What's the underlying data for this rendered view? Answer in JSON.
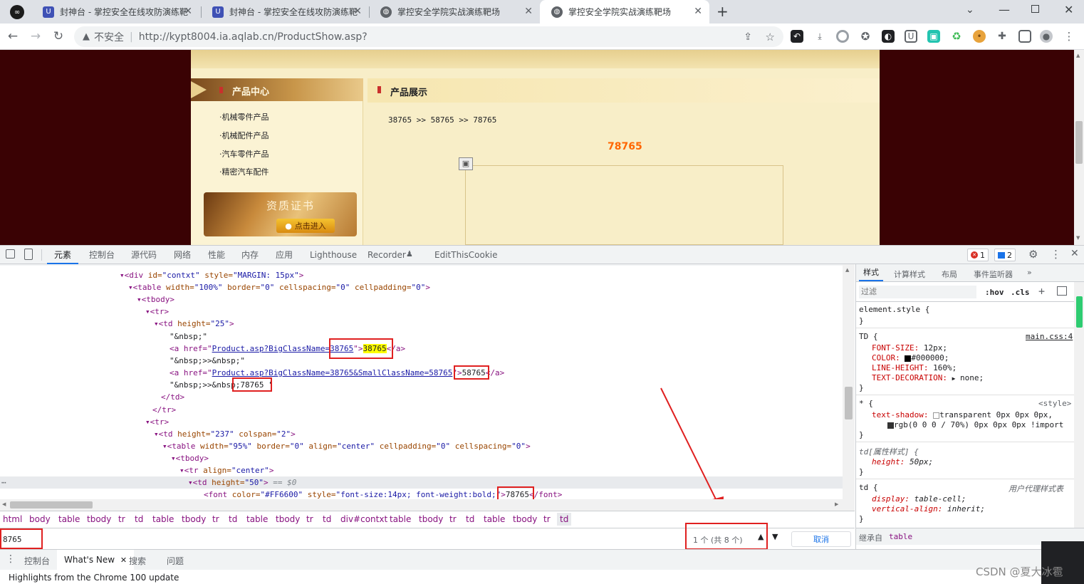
{
  "browser": {
    "tabs": [
      {
        "title": "封神台 - 掌控安全在线攻防演练靶"
      },
      {
        "title": "封神台 - 掌控安全在线攻防演练靶"
      },
      {
        "title": "掌控安全学院实战演练靶场"
      },
      {
        "title": "掌控安全学院实战演练靶场"
      }
    ],
    "security_label": "不安全",
    "url": "http://kypt8004.ia.aqlab.cn/ProductShow.asp?"
  },
  "site": {
    "sidebar_title": "产品中心",
    "sidebar_items": [
      "·机械零件产品",
      "·机械配件产品",
      "·汽车零件产品",
      "·精密汽车配件"
    ],
    "cert_title": "资质证书",
    "cert_button": "点击进入",
    "main_title": "产品展示",
    "breadcrumb": "38765 >> 58765 >> 78765",
    "product_id": "78765"
  },
  "devtools": {
    "tabs": [
      "元素",
      "控制台",
      "源代码",
      "网络",
      "性能",
      "内存",
      "应用",
      "Lighthouse",
      "Recorder",
      "EditThisCookie"
    ],
    "error_count": "1",
    "message_count": "2",
    "dom": {
      "line1": {
        "tag": "<div",
        "a1": "id=",
        "v1": "\"contxt\"",
        "a2": "style=",
        "v2": "\"MARGIN: 15px\"",
        "end": ">"
      },
      "line2": {
        "tag": "<table",
        "a1": "width=",
        "v1": "\"100%\"",
        "a2": "border=",
        "v2": "\"0\"",
        "a3": "cellspacing=",
        "v3": "\"0\"",
        "a4": "cellpadding=",
        "v4": "\"0\"",
        "end": ">"
      },
      "line3": "<tbody>",
      "line4": "<tr>",
      "line5": {
        "tag": "<td",
        "a1": "height=",
        "v1": "\"25\"",
        "end": ">"
      },
      "line6": "\"&nbsp;\"",
      "line7": {
        "pre": "<a href=\"",
        "link": "Product.asp?BigClassName=38765",
        "mid": "\">",
        "text": "38765",
        "end": "</a>"
      },
      "line8": "\"&nbsp;>>&nbsp;\"",
      "line9": {
        "pre": "<a href=\"",
        "link": "Product.asp?BigClassName=38765&SmallClassName=58765",
        "mid": "\">",
        "text": "58765",
        "end": "</a>"
      },
      "line10": "\"&nbsp;>>&nbsp;78765 \"",
      "line11": "</td>",
      "line12": "</tr>",
      "line13": "<tr>",
      "line14": {
        "tag": "<td",
        "a1": "height=",
        "v1": "\"237\"",
        "a2": "colspan=",
        "v2": "\"2\"",
        "end": ">"
      },
      "line15": {
        "tag": "<table",
        "a1": "width=",
        "v1": "\"95%\"",
        "a2": "border=",
        "v2": "\"0\"",
        "a3": "align=",
        "v3": "\"center\"",
        "a4": "cellpadding=",
        "v4": "\"0\"",
        "a5": "cellspacing=",
        "v5": "\"0\"",
        "end": ">"
      },
      "line16": "<tbody>",
      "line17": {
        "tag": "<tr",
        "a1": "align=",
        "v1": "\"center\"",
        "end": ">"
      },
      "line18": {
        "tag": "<td",
        "a1": "height=",
        "v1": "\"50\"",
        "end": ">",
        "dollar": "== $0"
      },
      "line19": {
        "tag": "<font",
        "a1": "color=",
        "v1": "\"#FF6600\"",
        "a2": "style=",
        "v2": "\"font-size:14px; font-weight:bold;\"",
        "mid": ">",
        "text": "78765",
        "end": "</font>"
      }
    },
    "breadcrumbs": [
      "html",
      "body",
      "table",
      "tbody",
      "tr",
      "td",
      "table",
      "tbody",
      "tr",
      "td",
      "table",
      "tbody",
      "tr",
      "td",
      "div#contxt",
      "table",
      "tbody",
      "tr",
      "td",
      "table",
      "tbody",
      "tr",
      "td"
    ],
    "search": {
      "value": "8765",
      "result": "1 个 (共 8 个)",
      "cancel": "取消"
    },
    "styles_tabs": [
      "样式",
      "计算样式",
      "布局",
      "事件监听器"
    ],
    "filter_placeholder": "过滤",
    "hov": ":hov",
    "cls": ".cls",
    "rules": {
      "element_style": "element.style {",
      "td_selector": "TD {",
      "td_source": "main.css:4",
      "td_props": [
        {
          "name": "FONT-SIZE:",
          "value": "12px;"
        },
        {
          "name": "COLOR:",
          "value": "#000000;"
        },
        {
          "name": "LINE-HEIGHT:",
          "value": "160%;"
        },
        {
          "name": "TEXT-DECORATION:",
          "value": "none;"
        }
      ],
      "star_selector": "* {",
      "star_source": "<style>",
      "star_prop_name": "text-shadow:",
      "star_prop_value1": "transparent 0px 0px 0px,",
      "star_prop_value2": "rgb(0 0 0 / 70%) 0px 0px 0px !import",
      "attr_selector": "td[属性样式] {",
      "attr_prop_name": "height:",
      "attr_prop_value": "50px;",
      "ua_selector": "td {",
      "ua_source": "用户代理样式表",
      "ua_props": [
        {
          "name": "display:",
          "value": "table-cell;"
        },
        {
          "name": "vertical-align:",
          "value": "inherit;"
        }
      ],
      "brace": "}",
      "inherit_label": "继承自",
      "inherit_tag": "table"
    },
    "drawer_tabs": [
      "控制台",
      "What's New",
      "搜索",
      "问题"
    ],
    "drawer_text": "Highlights from the Chrome 100 update"
  },
  "watermark": "CSDN @夏大冰雹",
  "colors": {
    "accent": "#1a73e8",
    "highlight_box": "#e02020",
    "product_orange": "#ff6600",
    "page_bg": "#3a0204"
  }
}
